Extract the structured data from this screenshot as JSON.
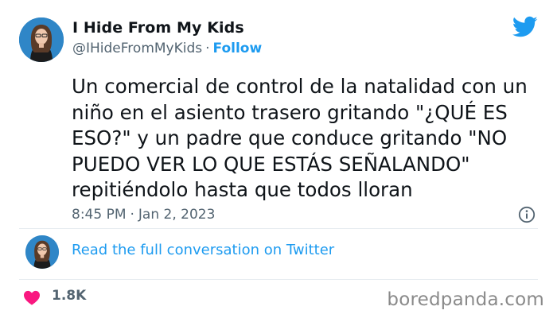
{
  "author": {
    "display_name": "I Hide From My Kids",
    "handle": "@IHideFromMyKids",
    "separator": "·",
    "follow_label": "Follow"
  },
  "tweet": {
    "text": "Un comercial de control de la natalidad con un niño en el asiento trasero gritando \"¿QUÉ ES ESO?\" y un padre que conduce gritando \"NO PUEDO VER LO QUE ESTÁS SEÑALANDO\" repitiéndolo hasta que todos lloran",
    "time": "8:45 PM",
    "separator": "·",
    "date": "Jan 2, 2023"
  },
  "conversation": {
    "link_label": "Read the full conversation on Twitter"
  },
  "stats": {
    "likes": "1.8K"
  },
  "watermark": "boredpanda.com",
  "icons": {
    "brand": "twitter-bird-icon",
    "info": "info-icon",
    "like": "heart-icon"
  },
  "colors": {
    "accent": "#1d9bf0",
    "heart": "#f91880",
    "secondary_text": "#536471",
    "primary_text": "#0f1419"
  }
}
